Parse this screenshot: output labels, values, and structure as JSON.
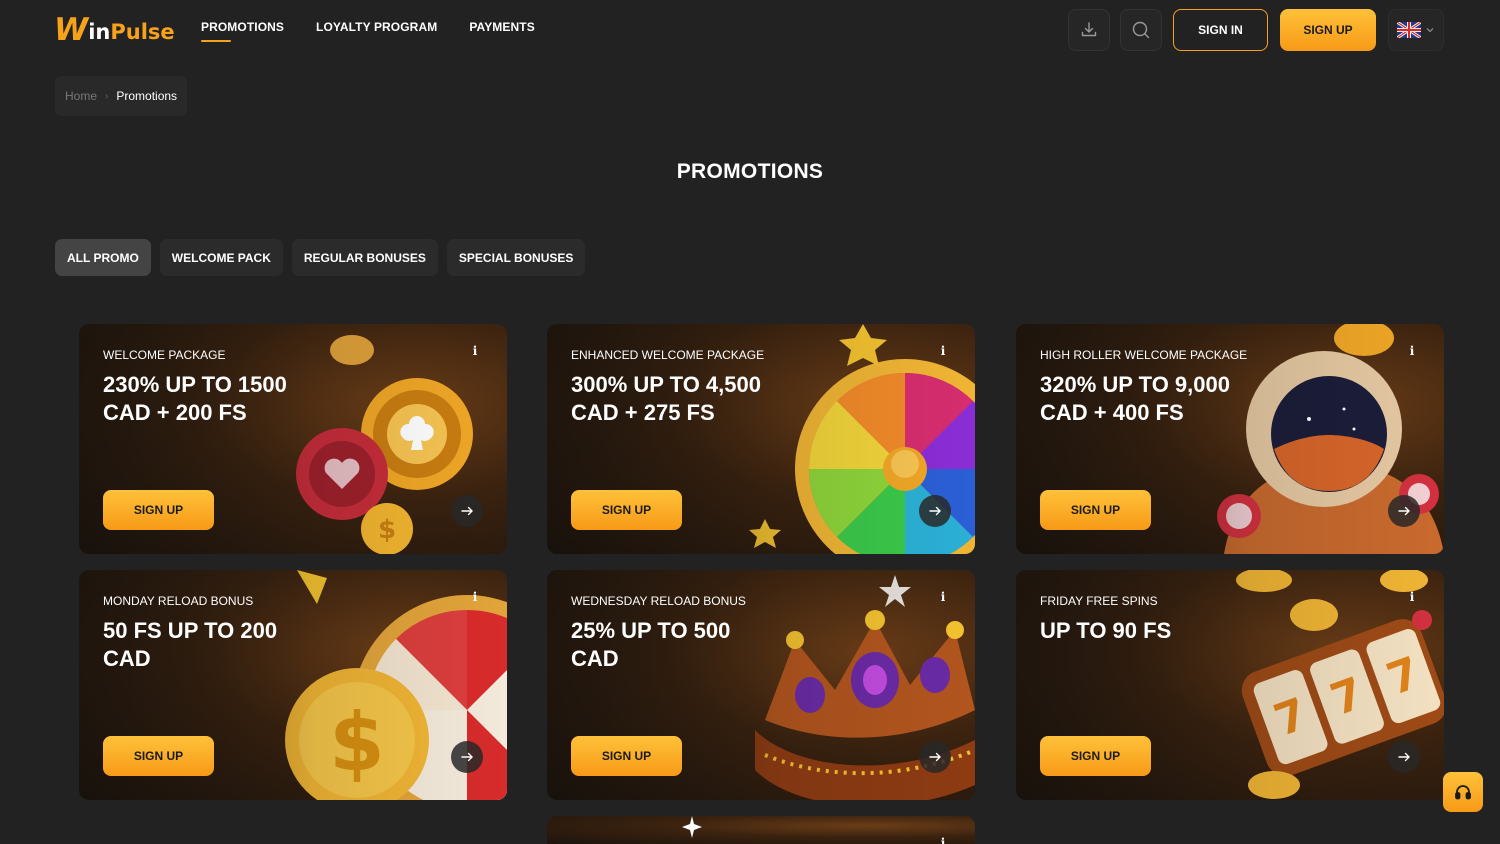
{
  "brand": {
    "logo_w": "W",
    "logo_in": "in",
    "logo_pulse": "Pulse"
  },
  "nav": [
    {
      "label": "PROMOTIONS",
      "active": true
    },
    {
      "label": "LOYALTY PROGRAM",
      "active": false
    },
    {
      "label": "PAYMENTS",
      "active": false
    }
  ],
  "header": {
    "signin_label": "SIGN IN",
    "signup_label": "SIGN UP",
    "download_icon": "download-icon",
    "search_icon": "search-icon",
    "language_icon": "uk-flag-icon"
  },
  "breadcrumb": {
    "home": "Home",
    "current": "Promotions"
  },
  "page": {
    "title": "PROMOTIONS"
  },
  "tabs": [
    {
      "label": "ALL PROMO",
      "active": true
    },
    {
      "label": "WELCOME PACK",
      "active": false
    },
    {
      "label": "REGULAR BONUSES",
      "active": false
    },
    {
      "label": "SPECIAL BONUSES",
      "active": false
    }
  ],
  "cards": [
    {
      "kicker": "WELCOME PACKAGE",
      "title": "230% UP TO 1500 CAD + 200 FS",
      "button": "SIGN UP",
      "art": "casino-chips"
    },
    {
      "kicker": "ENHANCED WELCOME PACKAGE",
      "title": "300% UP TO 4,500 CAD + 275 FS",
      "button": "SIGN UP",
      "art": "prize-wheel"
    },
    {
      "kicker": "HIGH ROLLER WELCOME PACKAGE",
      "title": "320% UP TO 9,000 CAD + 400 FS",
      "button": "SIGN UP",
      "art": "astronaut"
    },
    {
      "kicker": "MONDAY RELOAD BONUS",
      "title": "50 FS UP TO 200 CAD",
      "button": "SIGN UP",
      "art": "wheel-and-coin"
    },
    {
      "kicker": "WEDNESDAY RELOAD BONUS",
      "title": "25% UP TO 500 CAD",
      "button": "SIGN UP",
      "art": "crown"
    },
    {
      "kicker": "FRIDAY FREE SPINS",
      "title": "UP TO 90 FS",
      "button": "SIGN UP",
      "art": "slot-reels"
    }
  ],
  "colors": {
    "accent": "#f7a21b",
    "background": "#222222",
    "card": "#3a220f"
  }
}
